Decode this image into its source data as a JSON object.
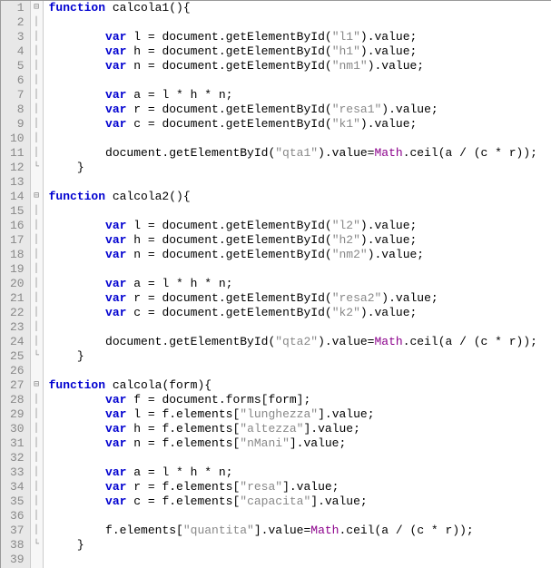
{
  "lines": [
    {
      "n": 1,
      "fold": "⊟",
      "segs": [
        {
          "t": "function ",
          "c": "kw"
        },
        {
          "t": "calcola1",
          "c": "fn"
        },
        {
          "t": "(){",
          "c": "op"
        }
      ]
    },
    {
      "n": 2,
      "fold": "|",
      "segs": []
    },
    {
      "n": 3,
      "fold": "|",
      "segs": [
        {
          "t": "        ",
          "c": ""
        },
        {
          "t": "var",
          "c": "kw"
        },
        {
          "t": " l = document.getElementById(",
          "c": ""
        },
        {
          "t": "\"l1\"",
          "c": "str"
        },
        {
          "t": ").value;",
          "c": ""
        }
      ]
    },
    {
      "n": 4,
      "fold": "|",
      "segs": [
        {
          "t": "        ",
          "c": ""
        },
        {
          "t": "var",
          "c": "kw"
        },
        {
          "t": " h = document.getElementById(",
          "c": ""
        },
        {
          "t": "\"h1\"",
          "c": "str"
        },
        {
          "t": ").value;",
          "c": ""
        }
      ]
    },
    {
      "n": 5,
      "fold": "|",
      "segs": [
        {
          "t": "        ",
          "c": ""
        },
        {
          "t": "var",
          "c": "kw"
        },
        {
          "t": " n = document.getElementById(",
          "c": ""
        },
        {
          "t": "\"nm1\"",
          "c": "str"
        },
        {
          "t": ").value;",
          "c": ""
        }
      ]
    },
    {
      "n": 6,
      "fold": "|",
      "segs": []
    },
    {
      "n": 7,
      "fold": "|",
      "segs": [
        {
          "t": "        ",
          "c": ""
        },
        {
          "t": "var",
          "c": "kw"
        },
        {
          "t": " a = l * h * n;",
          "c": ""
        }
      ]
    },
    {
      "n": 8,
      "fold": "|",
      "segs": [
        {
          "t": "        ",
          "c": ""
        },
        {
          "t": "var",
          "c": "kw"
        },
        {
          "t": " r = document.getElementById(",
          "c": ""
        },
        {
          "t": "\"resa1\"",
          "c": "str"
        },
        {
          "t": ").value;",
          "c": ""
        }
      ]
    },
    {
      "n": 9,
      "fold": "|",
      "segs": [
        {
          "t": "        ",
          "c": ""
        },
        {
          "t": "var",
          "c": "kw"
        },
        {
          "t": " c = document.getElementById(",
          "c": ""
        },
        {
          "t": "\"k1\"",
          "c": "str"
        },
        {
          "t": ").value;",
          "c": ""
        }
      ]
    },
    {
      "n": 10,
      "fold": "|",
      "segs": []
    },
    {
      "n": 11,
      "fold": "|",
      "segs": [
        {
          "t": "        document.getElementById(",
          "c": ""
        },
        {
          "t": "\"qta1\"",
          "c": "str"
        },
        {
          "t": ").value=",
          "c": ""
        },
        {
          "t": "Math",
          "c": "cls"
        },
        {
          "t": ".ceil(a / (c * r));",
          "c": ""
        }
      ]
    },
    {
      "n": 12,
      "fold": "└",
      "segs": [
        {
          "t": "    }",
          "c": ""
        }
      ]
    },
    {
      "n": 13,
      "fold": "",
      "segs": []
    },
    {
      "n": 14,
      "fold": "⊟",
      "segs": [
        {
          "t": "function ",
          "c": "kw"
        },
        {
          "t": "calcola2",
          "c": "fn"
        },
        {
          "t": "(){",
          "c": "op"
        }
      ]
    },
    {
      "n": 15,
      "fold": "|",
      "segs": []
    },
    {
      "n": 16,
      "fold": "|",
      "segs": [
        {
          "t": "        ",
          "c": ""
        },
        {
          "t": "var",
          "c": "kw"
        },
        {
          "t": " l = document.getElementById(",
          "c": ""
        },
        {
          "t": "\"l2\"",
          "c": "str"
        },
        {
          "t": ").value;",
          "c": ""
        }
      ]
    },
    {
      "n": 17,
      "fold": "|",
      "segs": [
        {
          "t": "        ",
          "c": ""
        },
        {
          "t": "var",
          "c": "kw"
        },
        {
          "t": " h = document.getElementById(",
          "c": ""
        },
        {
          "t": "\"h2\"",
          "c": "str"
        },
        {
          "t": ").value;",
          "c": ""
        }
      ]
    },
    {
      "n": 18,
      "fold": "|",
      "segs": [
        {
          "t": "        ",
          "c": ""
        },
        {
          "t": "var",
          "c": "kw"
        },
        {
          "t": " n = document.getElementById(",
          "c": ""
        },
        {
          "t": "\"nm2\"",
          "c": "str"
        },
        {
          "t": ").value;",
          "c": ""
        }
      ]
    },
    {
      "n": 19,
      "fold": "|",
      "segs": []
    },
    {
      "n": 20,
      "fold": "|",
      "segs": [
        {
          "t": "        ",
          "c": ""
        },
        {
          "t": "var",
          "c": "kw"
        },
        {
          "t": " a = l * h * n;",
          "c": ""
        }
      ]
    },
    {
      "n": 21,
      "fold": "|",
      "segs": [
        {
          "t": "        ",
          "c": ""
        },
        {
          "t": "var",
          "c": "kw"
        },
        {
          "t": " r = document.getElementById(",
          "c": ""
        },
        {
          "t": "\"resa2\"",
          "c": "str"
        },
        {
          "t": ").value;",
          "c": ""
        }
      ]
    },
    {
      "n": 22,
      "fold": "|",
      "segs": [
        {
          "t": "        ",
          "c": ""
        },
        {
          "t": "var",
          "c": "kw"
        },
        {
          "t": " c = document.getElementById(",
          "c": ""
        },
        {
          "t": "\"k2\"",
          "c": "str"
        },
        {
          "t": ").value;",
          "c": ""
        }
      ]
    },
    {
      "n": 23,
      "fold": "|",
      "segs": []
    },
    {
      "n": 24,
      "fold": "|",
      "segs": [
        {
          "t": "        document.getElementById(",
          "c": ""
        },
        {
          "t": "\"qta2\"",
          "c": "str"
        },
        {
          "t": ").value=",
          "c": ""
        },
        {
          "t": "Math",
          "c": "cls"
        },
        {
          "t": ".ceil(a / (c * r));",
          "c": ""
        }
      ]
    },
    {
      "n": 25,
      "fold": "└",
      "segs": [
        {
          "t": "    }",
          "c": ""
        }
      ]
    },
    {
      "n": 26,
      "fold": "",
      "segs": []
    },
    {
      "n": 27,
      "fold": "⊟",
      "segs": [
        {
          "t": "function ",
          "c": "kw"
        },
        {
          "t": "calcola",
          "c": "fn"
        },
        {
          "t": "(form){",
          "c": "op"
        }
      ]
    },
    {
      "n": 28,
      "fold": "|",
      "segs": [
        {
          "t": "        ",
          "c": ""
        },
        {
          "t": "var",
          "c": "kw"
        },
        {
          "t": " f = document.forms[form];",
          "c": ""
        }
      ]
    },
    {
      "n": 29,
      "fold": "|",
      "segs": [
        {
          "t": "        ",
          "c": ""
        },
        {
          "t": "var",
          "c": "kw"
        },
        {
          "t": " l = f.elements[",
          "c": ""
        },
        {
          "t": "\"lunghezza\"",
          "c": "str"
        },
        {
          "t": "].value;",
          "c": ""
        }
      ]
    },
    {
      "n": 30,
      "fold": "|",
      "segs": [
        {
          "t": "        ",
          "c": ""
        },
        {
          "t": "var",
          "c": "kw"
        },
        {
          "t": " h = f.elements[",
          "c": ""
        },
        {
          "t": "\"altezza\"",
          "c": "str"
        },
        {
          "t": "].value;",
          "c": ""
        }
      ]
    },
    {
      "n": 31,
      "fold": "|",
      "segs": [
        {
          "t": "        ",
          "c": ""
        },
        {
          "t": "var",
          "c": "kw"
        },
        {
          "t": " n = f.elements[",
          "c": ""
        },
        {
          "t": "\"nMani\"",
          "c": "str"
        },
        {
          "t": "].value;",
          "c": ""
        }
      ]
    },
    {
      "n": 32,
      "fold": "|",
      "segs": []
    },
    {
      "n": 33,
      "fold": "|",
      "segs": [
        {
          "t": "        ",
          "c": ""
        },
        {
          "t": "var",
          "c": "kw"
        },
        {
          "t": " a = l * h * n;",
          "c": ""
        }
      ]
    },
    {
      "n": 34,
      "fold": "|",
      "segs": [
        {
          "t": "        ",
          "c": ""
        },
        {
          "t": "var",
          "c": "kw"
        },
        {
          "t": " r = f.elements[",
          "c": ""
        },
        {
          "t": "\"resa\"",
          "c": "str"
        },
        {
          "t": "].value;",
          "c": ""
        }
      ]
    },
    {
      "n": 35,
      "fold": "|",
      "segs": [
        {
          "t": "        ",
          "c": ""
        },
        {
          "t": "var",
          "c": "kw"
        },
        {
          "t": " c = f.elements[",
          "c": ""
        },
        {
          "t": "\"capacita\"",
          "c": "str"
        },
        {
          "t": "].value;",
          "c": ""
        }
      ]
    },
    {
      "n": 36,
      "fold": "|",
      "segs": []
    },
    {
      "n": 37,
      "fold": "|",
      "segs": [
        {
          "t": "        f.elements[",
          "c": ""
        },
        {
          "t": "\"quantita\"",
          "c": "str"
        },
        {
          "t": "].value=",
          "c": ""
        },
        {
          "t": "Math",
          "c": "cls"
        },
        {
          "t": ".ceil(a / (c * r));",
          "c": ""
        }
      ]
    },
    {
      "n": 38,
      "fold": "└",
      "segs": [
        {
          "t": "    }",
          "c": ""
        }
      ]
    },
    {
      "n": 39,
      "fold": "",
      "segs": []
    }
  ]
}
